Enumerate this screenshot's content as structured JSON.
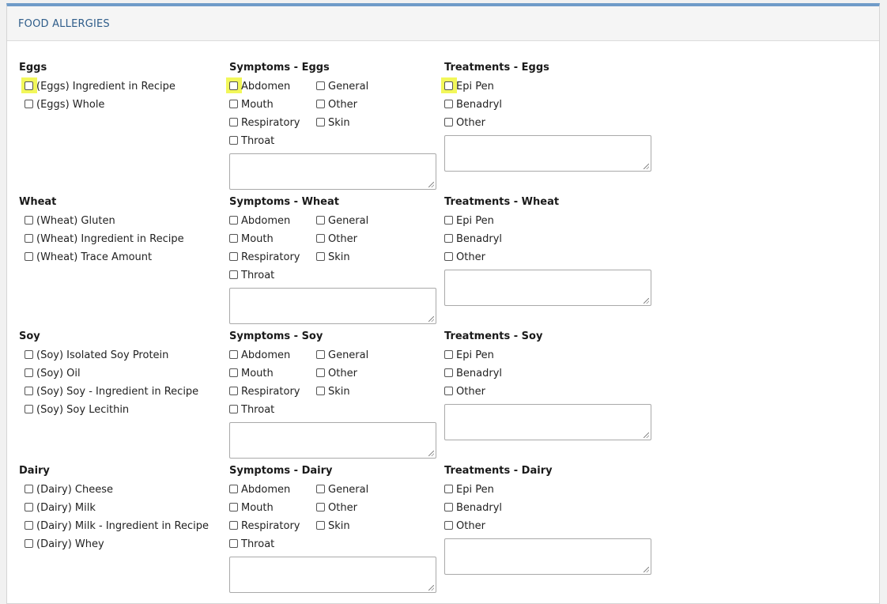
{
  "panel": {
    "title": "FOOD ALLERGIES"
  },
  "groups": [
    {
      "allergen": "Eggs",
      "options": [
        "(Eggs) Ingredient in Recipe",
        "(Eggs) Whole"
      ],
      "symptoms_title": "Symptoms - Eggs",
      "treatments_title": "Treatments - Eggs"
    },
    {
      "allergen": "Wheat",
      "options": [
        "(Wheat) Gluten",
        "(Wheat) Ingredient in Recipe",
        "(Wheat) Trace Amount"
      ],
      "symptoms_title": "Symptoms - Wheat",
      "treatments_title": "Treatments - Wheat"
    },
    {
      "allergen": "Soy",
      "options": [
        "(Soy) Isolated Soy Protein",
        "(Soy) Oil",
        "(Soy) Soy - Ingredient in Recipe",
        "(Soy) Soy Lecithin"
      ],
      "symptoms_title": "Symptoms - Soy",
      "treatments_title": "Treatments - Soy"
    },
    {
      "allergen": "Dairy",
      "options": [
        "(Dairy) Cheese",
        "(Dairy) Milk",
        "(Dairy) Milk - Ingredient in Recipe",
        "(Dairy) Whey"
      ],
      "symptoms_title": "Symptoms - Dairy",
      "treatments_title": "Treatments - Dairy"
    }
  ],
  "symptom_options": [
    "Abdomen",
    "General",
    "Mouth",
    "Other",
    "Respiratory",
    "Skin",
    "Throat"
  ],
  "treatment_options": [
    "Epi Pen",
    "Benadryl",
    "Other"
  ],
  "highlight_color": "#f2f75a",
  "accent_color": "#6f9bc8"
}
